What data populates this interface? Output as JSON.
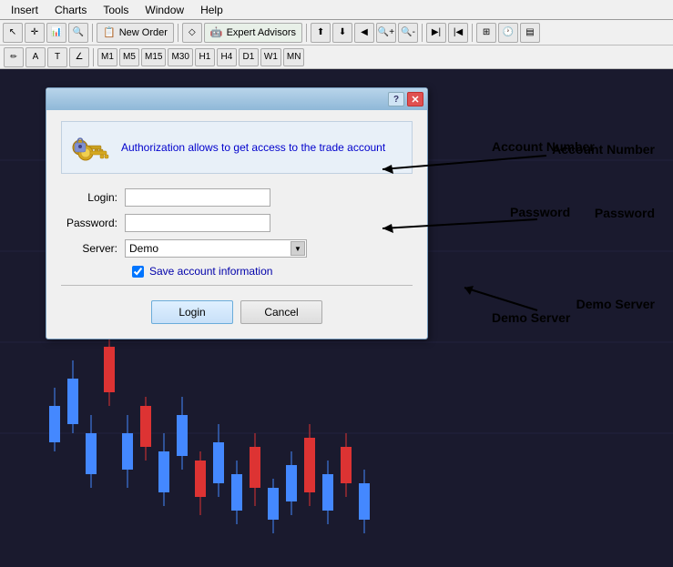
{
  "menubar": {
    "items": [
      "Insert",
      "Charts",
      "Tools",
      "Window",
      "Help"
    ]
  },
  "toolbar1": {
    "new_order_label": "New Order",
    "expert_advisors_label": "Expert Advisors"
  },
  "toolbar2": {
    "timeframes": [
      "M1",
      "M5",
      "M15",
      "M30",
      "H1",
      "H4",
      "D1",
      "W1",
      "MN"
    ]
  },
  "dialog": {
    "title": "",
    "header_text": "Authorization allows to get access to the trade account",
    "login_label": "Login:",
    "login_value": "",
    "password_label": "Password:",
    "password_value": "",
    "server_label": "Server:",
    "server_value": "Demo",
    "save_checkbox_label": "Save account information",
    "login_btn": "Login",
    "cancel_btn": "Cancel"
  },
  "annotations": {
    "account_number": "Account Number",
    "password": "Password",
    "demo_server": "Demo Server"
  }
}
